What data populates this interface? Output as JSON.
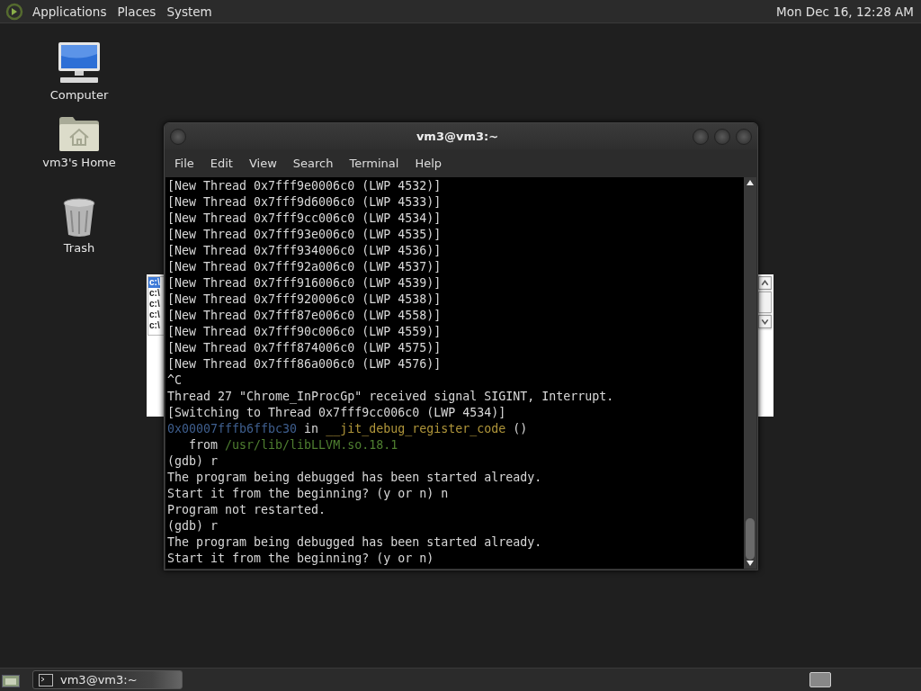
{
  "top_panel": {
    "menus": [
      "Applications",
      "Places",
      "System"
    ],
    "clock": "Mon Dec 16, 12:28 AM"
  },
  "desktop_icons": [
    {
      "label": "Computer",
      "kind": "computer"
    },
    {
      "label": "vm3's Home",
      "kind": "home"
    },
    {
      "label": "Trash",
      "kind": "trash"
    }
  ],
  "background_window": {
    "rows": [
      {
        "text": "c:\\",
        "selected": true
      },
      {
        "text": "c:\\",
        "selected": false
      },
      {
        "text": "c:\\",
        "selected": false
      },
      {
        "text": "c:\\",
        "selected": false
      },
      {
        "text": "c:\\",
        "selected": false
      }
    ]
  },
  "terminal": {
    "title": "vm3@vm3:~",
    "menu": [
      "File",
      "Edit",
      "View",
      "Search",
      "Terminal",
      "Help"
    ],
    "lines": [
      [
        {
          "text": "[New Thread 0x7fff9e0006c0 (LWP 4532)]",
          "kind": "plain"
        }
      ],
      [
        {
          "text": "[New Thread 0x7fff9d6006c0 (LWP 4533)]",
          "kind": "plain"
        }
      ],
      [
        {
          "text": "[New Thread 0x7fff9cc006c0 (LWP 4534)]",
          "kind": "plain"
        }
      ],
      [
        {
          "text": "[New Thread 0x7fff93e006c0 (LWP 4535)]",
          "kind": "plain"
        }
      ],
      [
        {
          "text": "[New Thread 0x7fff934006c0 (LWP 4536)]",
          "kind": "plain"
        }
      ],
      [
        {
          "text": "[New Thread 0x7fff92a006c0 (LWP 4537)]",
          "kind": "plain"
        }
      ],
      [
        {
          "text": "[New Thread 0x7fff916006c0 (LWP 4539)]",
          "kind": "plain"
        }
      ],
      [
        {
          "text": "[New Thread 0x7fff920006c0 (LWP 4538)]",
          "kind": "plain"
        }
      ],
      [
        {
          "text": "[New Thread 0x7fff87e006c0 (LWP 4558)]",
          "kind": "plain"
        }
      ],
      [
        {
          "text": "[New Thread 0x7fff90c006c0 (LWP 4559)]",
          "kind": "plain"
        }
      ],
      [
        {
          "text": "[New Thread 0x7fff874006c0 (LWP 4575)]",
          "kind": "plain"
        }
      ],
      [
        {
          "text": "[New Thread 0x7fff86a006c0 (LWP 4576)]",
          "kind": "plain"
        }
      ],
      [
        {
          "text": "^C",
          "kind": "plain"
        }
      ],
      [
        {
          "text": "Thread 27 \"Chrome_InProcGp\" received signal SIGINT, Interrupt.",
          "kind": "plain"
        }
      ],
      [
        {
          "text": "[Switching to Thread 0x7fff9cc006c0 (LWP 4534)]",
          "kind": "plain"
        }
      ],
      [
        {
          "text": "0x00007fffb6ffbc30",
          "kind": "address"
        },
        {
          "text": " in ",
          "kind": "plain"
        },
        {
          "text": "__jit_debug_register_code",
          "kind": "function"
        },
        {
          "text": " ()",
          "kind": "plain"
        }
      ],
      [
        {
          "text": "   from ",
          "kind": "plain"
        },
        {
          "text": "/usr/lib/libLLVM.so.18.1",
          "kind": "path"
        }
      ],
      [
        {
          "text": "(gdb) r",
          "kind": "plain"
        }
      ],
      [
        {
          "text": "The program being debugged has been started already.",
          "kind": "plain"
        }
      ],
      [
        {
          "text": "Start it from the beginning? (y or n) n",
          "kind": "plain"
        }
      ],
      [
        {
          "text": "Program not restarted.",
          "kind": "plain"
        }
      ],
      [
        {
          "text": "(gdb) r",
          "kind": "plain"
        }
      ],
      [
        {
          "text": "The program being debugged has been started already.",
          "kind": "plain"
        }
      ],
      [
        {
          "text": "Start it from the beginning? (y or n)",
          "kind": "plain"
        }
      ]
    ]
  },
  "taskbar": {
    "tasks": [
      {
        "label": "vm3@vm3:~",
        "selected": false
      }
    ]
  }
}
